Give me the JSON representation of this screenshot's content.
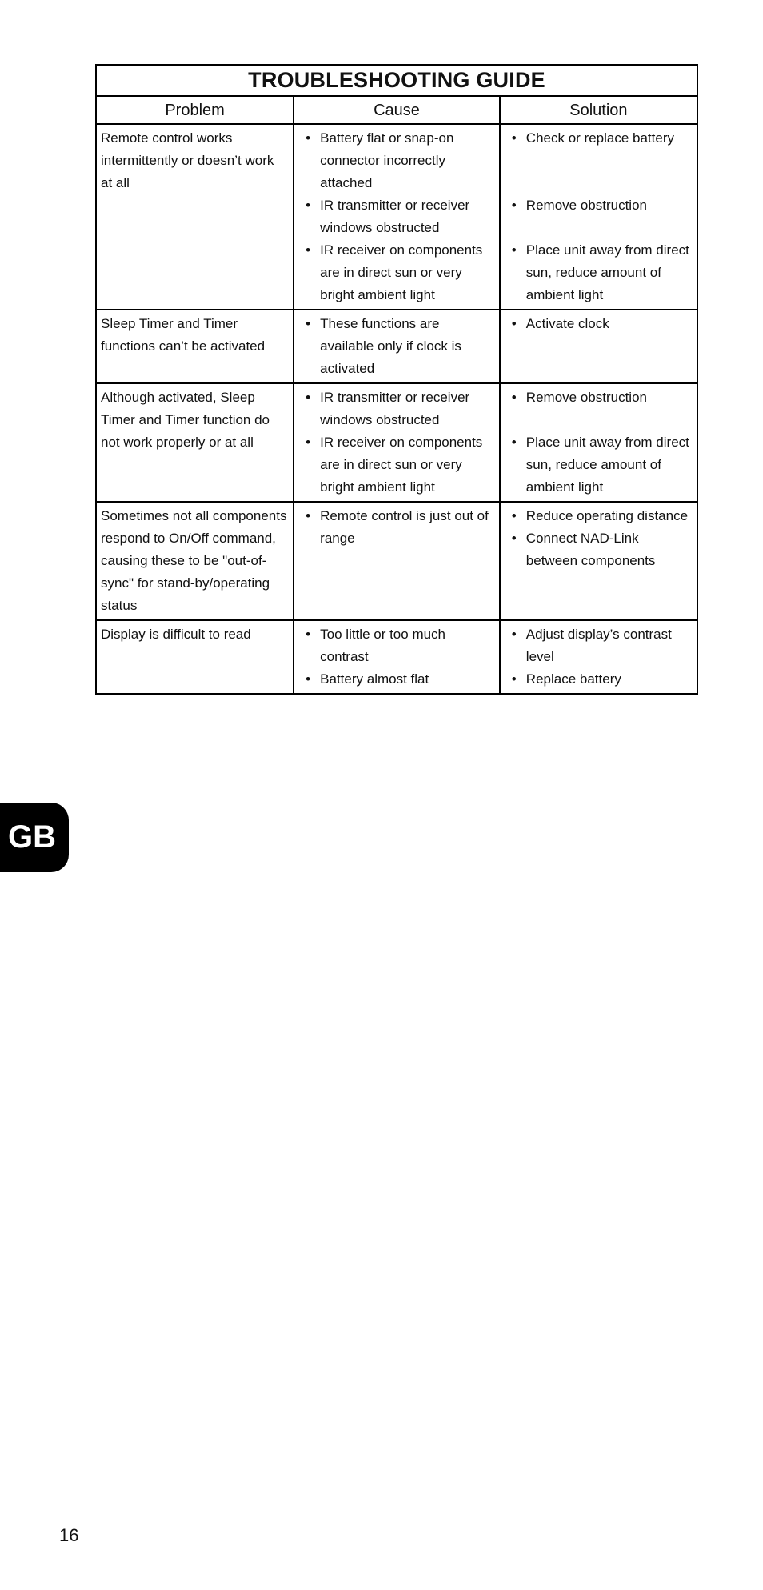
{
  "title": "TROUBLESHOOTING GUIDE",
  "columns": {
    "problem": "Problem",
    "cause": "Cause",
    "solution": "Solution"
  },
  "rows": [
    {
      "problem": "Remote control works intermittently or doesn’t work at all",
      "causes": [
        "Battery flat or snap-on connector incorrectly attached",
        "IR transmitter or receiver windows obstructed",
        "IR receiver on components are  in direct sun or very bright ambient light"
      ],
      "solutions": [
        "Check or replace battery",
        "Remove obstruction",
        "Place unit away from direct sun, reduce amount of ambient light"
      ]
    },
    {
      "problem": "Sleep Timer and Timer functions can’t be activated",
      "causes": [
        "These functions are available only if clock is activated"
      ],
      "solutions": [
        "Activate clock"
      ]
    },
    {
      "problem": "Although activated, Sleep Timer and Timer function do not work properly or at all",
      "causes": [
        "IR transmitter or receiver windows obstructed",
        "IR receiver on components are in direct sun or very bright ambient light"
      ],
      "solutions": [
        "Remove obstruction",
        "Place unit away from direct sun, reduce amount of ambient light"
      ]
    },
    {
      "problem": "Sometimes not all components respond to On/Off command, causing these to be \"out-of-sync\" for stand-by/operating status",
      "causes": [
        "Remote control is just out of range"
      ],
      "solutions": [
        "Reduce operating distance",
        "Connect NAD-Link between components"
      ]
    },
    {
      "problem": "Display is difficult to read",
      "causes": [
        "Too little or too much contrast",
        "Battery almost flat"
      ],
      "solutions": [
        "Adjust display’s contrast level",
        "Replace battery"
      ]
    }
  ],
  "bullet": "•",
  "language_tab": "GB",
  "page_number": "16"
}
